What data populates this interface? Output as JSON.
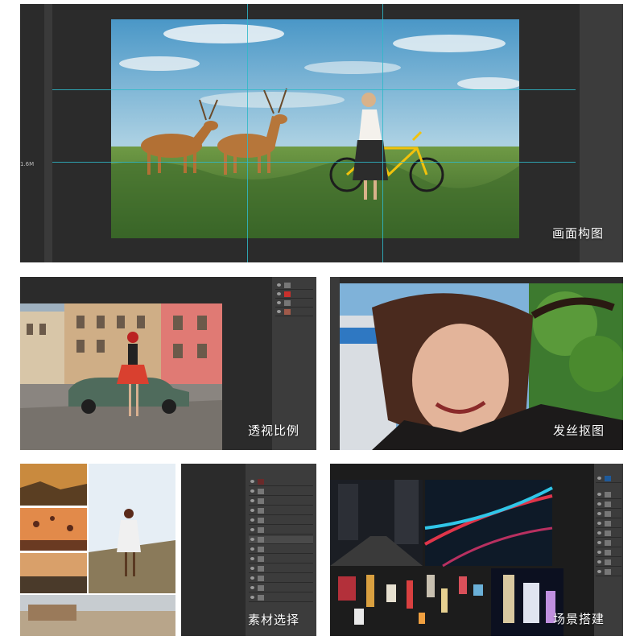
{
  "panels": {
    "composition": {
      "caption": "画面构图",
      "zoom_label": "1.6M"
    },
    "perspective": {
      "caption": "透视比例"
    },
    "hair": {
      "caption": "发丝抠图"
    },
    "materials": {
      "caption": "素材选择"
    },
    "scene": {
      "caption": "场景搭建"
    }
  },
  "colors": {
    "ps_bg": "#2b2b2b",
    "guide": "#2fb9c9",
    "caption_text": "#ffffff"
  }
}
